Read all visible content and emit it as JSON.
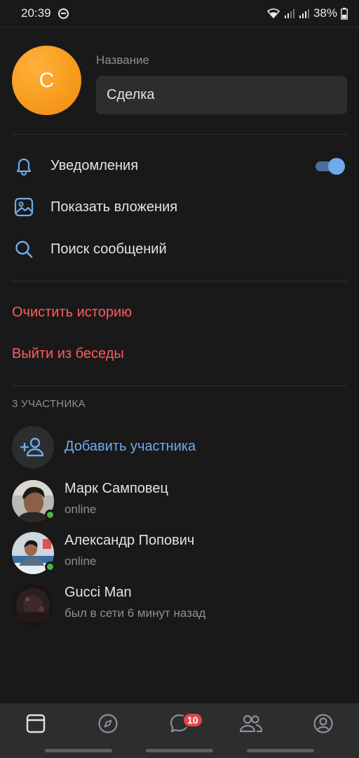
{
  "status_bar": {
    "time": "20:39",
    "battery": "38%"
  },
  "header": {
    "avatar_letter": "С",
    "name_label": "Название",
    "name_value": "Сделка"
  },
  "menu": {
    "notifications": {
      "label": "Уведомления",
      "toggle_on": true
    },
    "attachments": {
      "label": "Показать вложения"
    },
    "search": {
      "label": "Поиск сообщений"
    }
  },
  "actions": {
    "clear_history": "Очистить историю",
    "leave_chat": "Выйти из беседы"
  },
  "members": {
    "title": "3 УЧАСТНИКА",
    "add_label": "Добавить участника",
    "list": [
      {
        "name": "Марк Самповец",
        "status": "online",
        "online": true
      },
      {
        "name": "Александр Попович",
        "status": "online",
        "online": true
      },
      {
        "name": "Gucci Man",
        "status": "был в сети 6 минут назад",
        "online": false
      }
    ]
  },
  "tabbar": {
    "icons": [
      "news-icon",
      "explore-icon",
      "messages-icon",
      "friends-icon",
      "profile-icon"
    ],
    "messages_badge": "10"
  },
  "colors": {
    "accent": "#71aaeb",
    "danger": "#ff5c5c",
    "online": "#4bb34b",
    "avatar_orange": "#f79d1e"
  }
}
